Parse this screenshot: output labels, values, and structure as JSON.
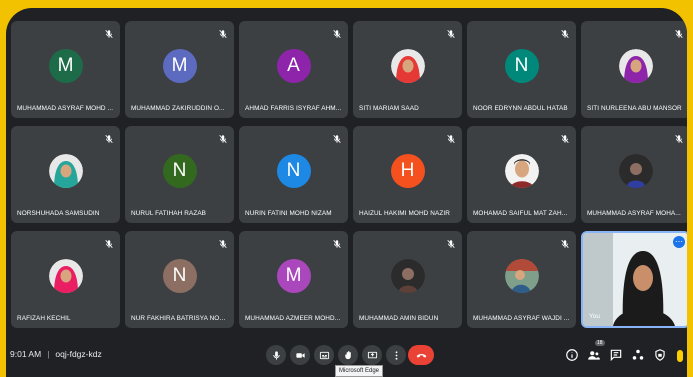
{
  "participants": [
    {
      "name": "MUHAMMAD ASYRAF MOHD ...",
      "initial": "M",
      "color": "#1e6b4a",
      "photo": false
    },
    {
      "name": "MUHAMMAD ZAKIRUDDIN O...",
      "initial": "M",
      "color": "#5c6bc0",
      "photo": false
    },
    {
      "name": "AHMAD FARRIS ISYRAF AHM...",
      "initial": "A",
      "color": "#8e24aa",
      "photo": false
    },
    {
      "name": "SITI MARIAM SAAD",
      "initial": "",
      "color": "#e53935",
      "photo": true,
      "photo_kind": "hijab-red"
    },
    {
      "name": "NOOR EDRYNN ABDUL HATAB",
      "initial": "N",
      "color": "#00897b",
      "photo": false
    },
    {
      "name": "SITI NURLEENA ABU MANSOR",
      "initial": "",
      "color": "#8e24aa",
      "photo": true,
      "photo_kind": "hijab-purple"
    },
    {
      "name": "NORSHUHADA SAMSUDIN",
      "initial": "",
      "color": "#26a69a",
      "photo": true,
      "photo_kind": "hijab-teal"
    },
    {
      "name": "NURUL FATIHAH RAZAB",
      "initial": "N",
      "color": "#33691e",
      "photo": false
    },
    {
      "name": "NURIN FATINI MOHD NIZAM",
      "initial": "N",
      "color": "#1e88e5",
      "photo": false
    },
    {
      "name": "HAIZUL HAKIMI MOHD NAZIR",
      "initial": "H",
      "color": "#f4511e",
      "photo": false
    },
    {
      "name": "MOHAMAD SAIFUL MAT ZAH...",
      "initial": "",
      "color": "#c9a27c",
      "photo": true,
      "photo_kind": "man-face"
    },
    {
      "name": "MUHAMMAD ASYRAF MOHA...",
      "initial": "",
      "color": "#303f9f",
      "photo": true,
      "photo_kind": "man-dark"
    },
    {
      "name": "RAFIZAH KECHIL",
      "initial": "",
      "color": "#e91e63",
      "photo": true,
      "photo_kind": "hijab-pink"
    },
    {
      "name": "NUR FAKHIRA BATRISYA NOR ...",
      "initial": "N",
      "color": "#8d6e63",
      "photo": false
    },
    {
      "name": "MUHAMMAD AZMEER MOHD...",
      "initial": "M",
      "color": "#ab47bc",
      "photo": false
    },
    {
      "name": "MUHAMMAD AMIN BIDUN",
      "initial": "",
      "color": "#5d4037",
      "photo": true,
      "photo_kind": "man-dark"
    },
    {
      "name": "MUHAMMAD ASYRAF WAJDI ...",
      "initial": "",
      "color": "#795548",
      "photo": true,
      "photo_kind": "man-scene"
    },
    {
      "name": "You",
      "initial": "",
      "color": "#9ccc65",
      "photo": true,
      "photo_kind": "self-video"
    }
  ],
  "bottom_bar": {
    "time": "9:01 AM",
    "meeting_code": "oqj-fdgz-kdz",
    "tooltip": "Microsoft Edge",
    "participants_count": "18"
  },
  "icons": [
    "mic-icon",
    "camera-icon",
    "captions-icon",
    "raise-hand-icon",
    "present-icon",
    "more-options-icon",
    "end-call-icon",
    "info-icon",
    "people-icon",
    "chat-icon",
    "activities-icon",
    "host-controls-icon"
  ]
}
